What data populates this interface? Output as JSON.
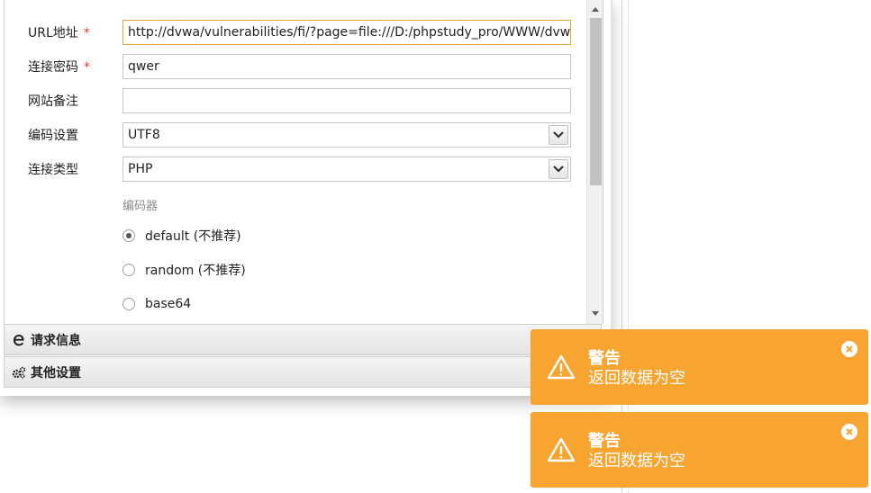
{
  "form": {
    "url_label": "URL地址",
    "url_value": "http://dvwa/vulnerabilities/fi/?page=file:///D:/phpstudy_pro/WWW/dvwa/",
    "password_label": "连接密码",
    "password_value": "qwer",
    "note_label": "网站备注",
    "note_value": "",
    "encoding_label": "编码设置",
    "encoding_value": "UTF8",
    "type_label": "连接类型",
    "type_value": "PHP",
    "required_mark": "*",
    "encoder_heading": "编码器",
    "encoders": [
      {
        "label": "default (不推荐)",
        "checked": true
      },
      {
        "label": "random (不推荐)",
        "checked": false
      },
      {
        "label": "base64",
        "checked": false
      }
    ]
  },
  "panels": [
    {
      "title": "请求信息",
      "icon": "request-e-icon"
    },
    {
      "title": "其他设置",
      "icon": "gears-icon"
    }
  ],
  "toasts": [
    {
      "title": "警告",
      "message": "返回数据为空"
    },
    {
      "title": "警告",
      "message": "返回数据为空"
    }
  ],
  "colors": {
    "toast_bg": "#f7a431",
    "focus_border": "#e2a438",
    "required": "#e53935"
  }
}
